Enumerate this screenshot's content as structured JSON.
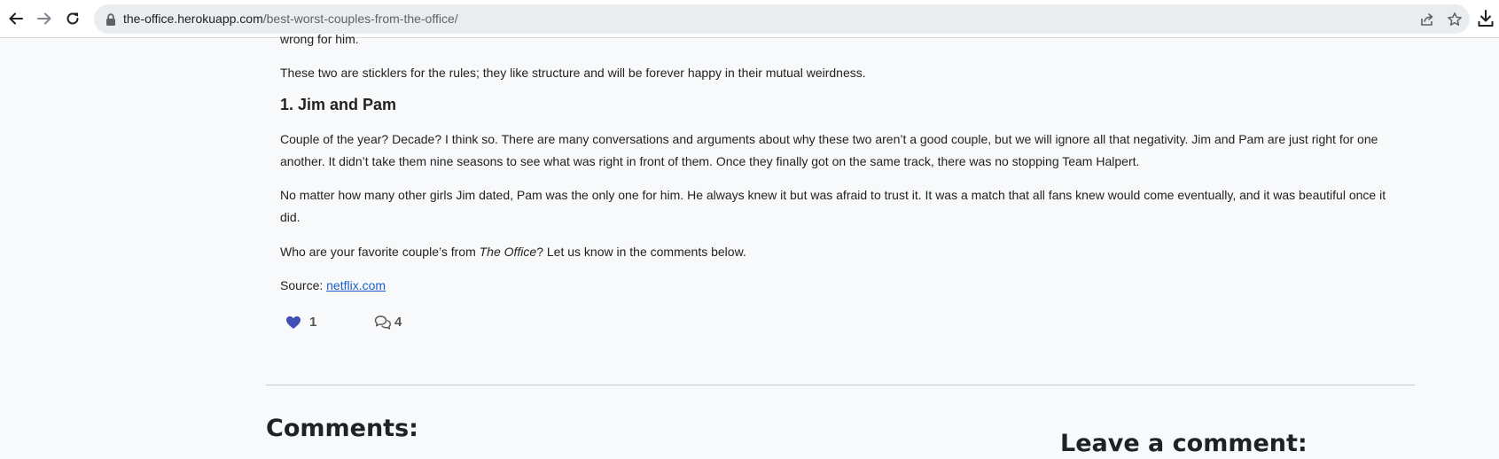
{
  "browser": {
    "url_host": "the-office.herokuapp.com",
    "url_path": "/best-worst-couples-from-the-office/",
    "icons": {
      "back": "arrow-left-icon",
      "forward": "arrow-right-icon",
      "reload": "reload-icon",
      "lock": "lock-icon",
      "share": "share-icon",
      "bookmark": "star-icon",
      "download": "download-icon"
    }
  },
  "article": {
    "cut_line": "wrong for him.",
    "p_sticklers": "These two are sticklers for the rules; they like structure and will be forever happy in their mutual weirdness.",
    "heading_jim_pam": "1. Jim and Pam",
    "p_couple_of_year": "Couple of the year? Decade? I think so. There are many conversations and arguments about why these two aren’t a good couple, but we will ignore all that negativity. Jim and Pam are just right for one another. It didn’t take them nine seasons to see what was right in front of them. Once they finally got on the same track, there was no stopping Team Halpert.",
    "p_no_matter": "No matter how many other girls Jim dated, Pam was the only one for him. He always knew it but was afraid to trust it. It was a match that all fans knew would come eventually, and it was beautiful once it did.",
    "p_favorite_prefix": "Who are your favorite couple’s from ",
    "p_favorite_italic": "The Office",
    "p_favorite_suffix": "? Let us know in the comments below.",
    "source_label": "Source: ",
    "source_link": "netflix.com"
  },
  "engagement": {
    "likes": "1",
    "comments": "4",
    "like_color": "#3f4fb4"
  },
  "comments_section": {
    "title": "Comments:",
    "leave_title": "Leave a comment:"
  }
}
